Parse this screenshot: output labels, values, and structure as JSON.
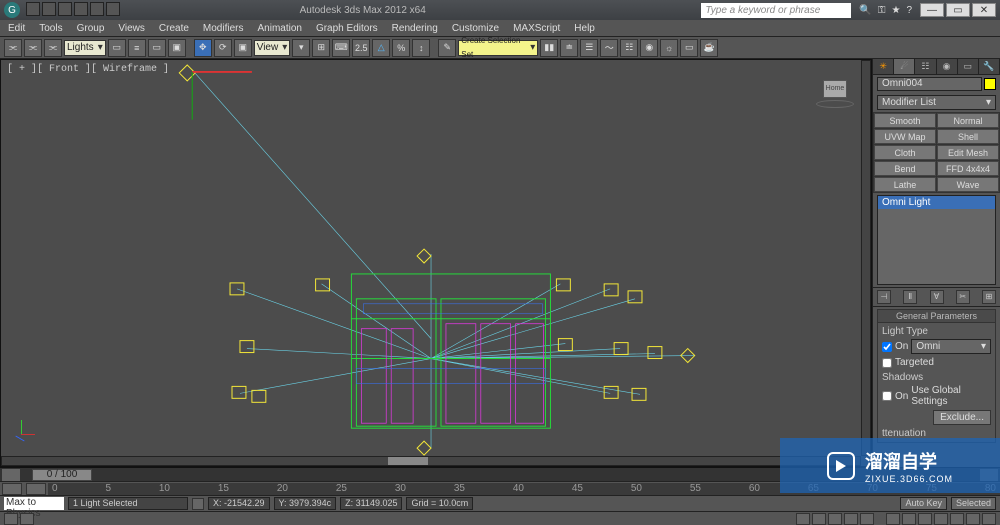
{
  "app_title": "Autodesk 3ds Max 2012 x64",
  "search_placeholder": "Type a keyword or phrase",
  "menus": [
    "Edit",
    "Tools",
    "Group",
    "Views",
    "Create",
    "Modifiers",
    "Animation",
    "Graph Editors",
    "Rendering",
    "Customize",
    "MAXScript",
    "Help"
  ],
  "toolbar": {
    "lights_combo": "Lights",
    "view_combo": "View",
    "spinner": "2.5",
    "selset": "Create Selection Set"
  },
  "viewport_label": "[ + ][ Front ][ Wireframe ]",
  "home_label": "Home",
  "sidepanel": {
    "object_name": "Omni004",
    "modifier_combo": "Modifier List",
    "mod_buttons": [
      "Smooth",
      "Normal",
      "UVW Map",
      "Shell",
      "Cloth",
      "Edit Mesh",
      "Bend",
      "FFD 4x4x4",
      "Lathe",
      "Wave"
    ],
    "stack_sel": "Omni Light",
    "rollout_gen": "General Parameters",
    "light_type": "Light Type",
    "on": "On",
    "type_combo": "Omni",
    "targeted": "Targeted",
    "shadows": "Shadows",
    "use_global": "Use Global Settings",
    "exclude": "Exclude...",
    "atten": "ttenuation"
  },
  "timeline": {
    "thumb": "0 / 100",
    "ticks": [
      "0",
      "5",
      "10",
      "15",
      "20",
      "25",
      "30",
      "35",
      "40",
      "45",
      "50",
      "55",
      "60",
      "65",
      "70",
      "75",
      "80"
    ]
  },
  "status": {
    "selected": "1 Light Selected",
    "x": "X: -21542.29",
    "y": "Y: 3979.394c",
    "z": "Z: 31149.025",
    "grid": "Grid = 10.0cm",
    "autokey": "Auto Key",
    "selected2": "Selected"
  },
  "prompt": "Max to Physics",
  "watermark": {
    "big": "溜溜自学",
    "sub": "ZIXUE.3D66.COM"
  }
}
